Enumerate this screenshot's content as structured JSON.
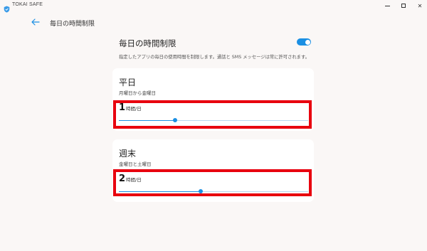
{
  "window": {
    "app_title": "TOKAI SAFE",
    "app_icon": "shield-icon",
    "controls": {
      "minimize_icon": "minimize-icon",
      "maximize_icon": "maximize-icon",
      "close_glyph": "✕"
    }
  },
  "header": {
    "back_icon": "arrow-left-icon",
    "title": "毎日の時間制限"
  },
  "section": {
    "title": "毎日の時間制限",
    "toggle_on": true,
    "description": "指定したアプリの毎日の使用時間を制限します。通話と SMS メッセージは常に許可されます。"
  },
  "cards": [
    {
      "title": "平日",
      "subtitle": "月曜日から金曜日",
      "value": "1",
      "unit": "時間/日",
      "slider_fraction": 0.296
    },
    {
      "title": "週末",
      "subtitle": "金曜日と土曜日",
      "value": "2",
      "unit": "時間/日",
      "slider_fraction": 0.432
    }
  ],
  "colors": {
    "accent": "#1a8fe3",
    "highlight": "#e8000e",
    "background": "#faf7f6",
    "card": "#ffffff"
  }
}
